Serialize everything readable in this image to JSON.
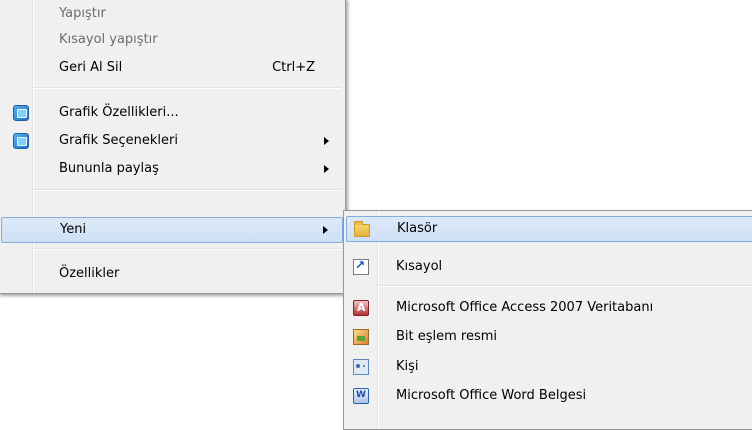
{
  "context_menu": {
    "items": [
      {
        "label": "Yapıştır"
      },
      {
        "label": "Kısayol yapıştır"
      },
      {
        "label": "Geri Al Sil",
        "shortcut": "Ctrl+Z"
      },
      {
        "label": "Grafik Özellikleri...",
        "icon": "intel-graphics-icon"
      },
      {
        "label": "Grafik Seçenekleri",
        "icon": "intel-graphics-icon"
      },
      {
        "label": "Bununla paylaş"
      },
      {
        "label": "Yeni"
      },
      {
        "label": "Özellikler"
      }
    ]
  },
  "new_submenu": {
    "items": [
      {
        "label": "Klasör",
        "icon": "folder-icon"
      },
      {
        "label": "Kısayol",
        "icon": "shortcut-icon"
      },
      {
        "label": "Microsoft Office Access 2007 Veritabanı",
        "icon": "access-icon"
      },
      {
        "label": "Bit eşlem resmi",
        "icon": "bitmap-icon"
      },
      {
        "label": "Kişi",
        "icon": "contact-icon"
      },
      {
        "label": "Microsoft Office Word Belgesi",
        "icon": "word-icon"
      }
    ]
  }
}
